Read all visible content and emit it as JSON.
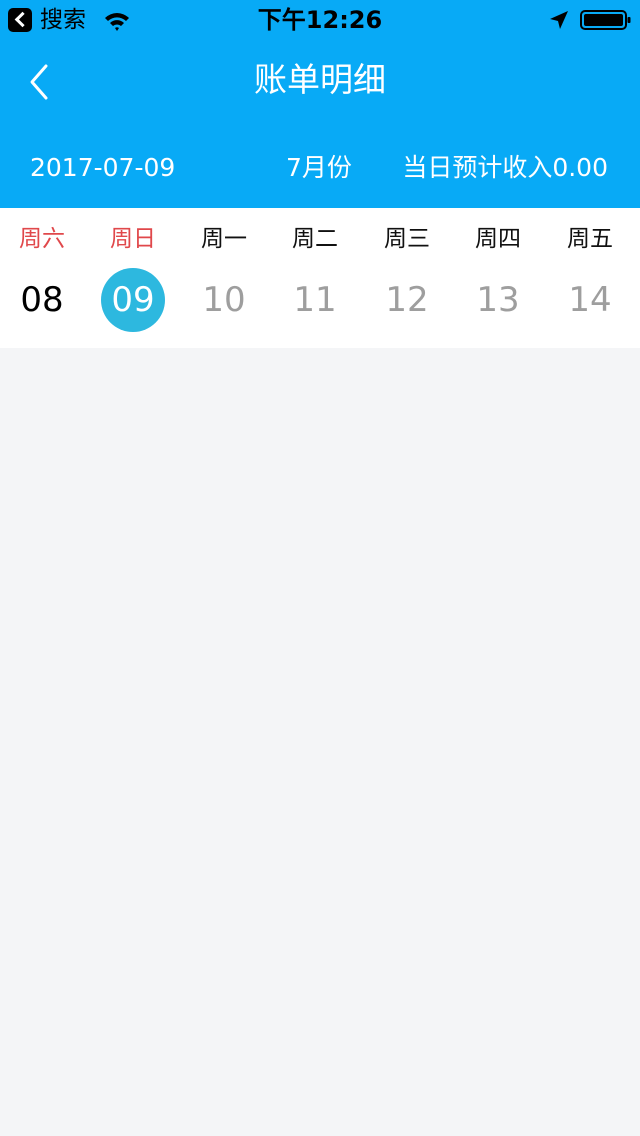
{
  "status_bar": {
    "back_app": "搜索",
    "time": "下午12:26"
  },
  "nav": {
    "title": "账单明细"
  },
  "info": {
    "date": "2017-07-09",
    "month": "7月份",
    "income": "当日预计收入0.00"
  },
  "week": {
    "days": [
      {
        "label": "周六",
        "num": "08"
      },
      {
        "label": "周日",
        "num": "09"
      },
      {
        "label": "周一",
        "num": "10"
      },
      {
        "label": "周二",
        "num": "11"
      },
      {
        "label": "周三",
        "num": "12"
      },
      {
        "label": "周四",
        "num": "13"
      },
      {
        "label": "周五",
        "num": "14"
      }
    ]
  },
  "colors": {
    "header_bg": "#08aaf6",
    "weekend_label": "#e0484b",
    "selected_day_bg": "#2db8df",
    "future_day_text": "#9e9e9e",
    "content_bg": "#f4f5f7"
  },
  "icons": {
    "status_back": "back-to-app-icon",
    "wifi": "wifi-icon",
    "location": "location-arrow-icon",
    "battery": "battery-icon",
    "nav_back": "chevron-left-icon"
  }
}
